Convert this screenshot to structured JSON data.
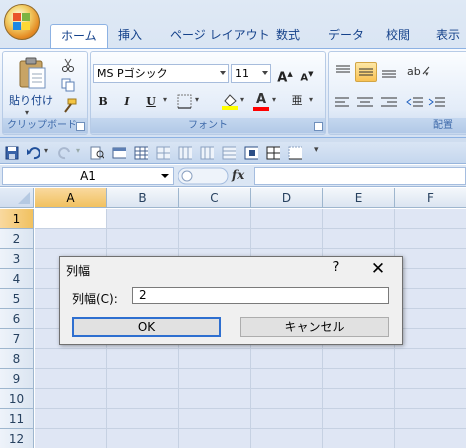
{
  "ribbon": {
    "tabs": [
      {
        "label": "ホーム",
        "active": true
      },
      {
        "label": "挿入"
      },
      {
        "label": "ページ レイアウト"
      },
      {
        "label": "数式"
      },
      {
        "label": "データ"
      },
      {
        "label": "校閲"
      },
      {
        "label": "表示"
      }
    ],
    "clipboard": {
      "paste_label": "貼り付け",
      "group_label": "クリップボード"
    },
    "font": {
      "font_name": "MS Pゴシック",
      "font_size": "11",
      "group_label": "フォント",
      "bold": "B",
      "italic": "I",
      "underline": "U",
      "grow": "A",
      "shrink": "A",
      "text_color": "A",
      "phonetic": "亜"
    },
    "alignment": {
      "group_label": "配置"
    },
    "colors": {
      "accent": "#15428b",
      "highlight": "#f9c254",
      "font_color_bar": "#ff0000",
      "fill_color_bar": "#ffff00"
    }
  },
  "formula_bar": {
    "name_box": "A1",
    "fx": "fx",
    "content": ""
  },
  "grid": {
    "columns": [
      "A",
      "B",
      "C",
      "D",
      "E",
      "F"
    ],
    "rows": [
      "1",
      "2",
      "3",
      "4",
      "5",
      "6",
      "7",
      "8",
      "9",
      "10",
      "11",
      "12"
    ],
    "active_column": "A",
    "active_row": "1"
  },
  "dialog": {
    "title": "列幅",
    "help": "?",
    "close": "✕",
    "label": "列幅(C):",
    "value": "2",
    "ok_label": "OK",
    "cancel_label": "キャンセル"
  }
}
